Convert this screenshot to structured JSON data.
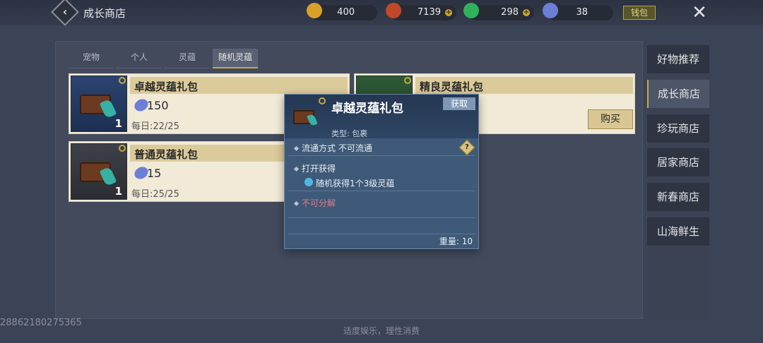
{
  "header": {
    "title": "成长商店",
    "currencies": [
      {
        "name": "gold",
        "value": "400",
        "color": "#d9a12a"
      },
      {
        "name": "copper",
        "value": "7139",
        "color": "#c0482a"
      },
      {
        "name": "jade",
        "value": "298",
        "color": "#2fb35a"
      },
      {
        "name": "crystal",
        "value": "38",
        "color": "#6c7fd6"
      }
    ],
    "wallet_label": "钱包"
  },
  "tabs": [
    {
      "label": "宠物"
    },
    {
      "label": "个人"
    },
    {
      "label": "灵蕴"
    },
    {
      "label": "随机灵蕴",
      "active": true
    }
  ],
  "items": [
    {
      "name": "卓越灵蕴礼包",
      "price": "150",
      "daily": "每日:22/25",
      "count": "1",
      "thumb_color": "blue"
    },
    {
      "name": "精良灵蕴礼包",
      "buy_label": "购买",
      "thumb_color": "green"
    },
    {
      "name": "普通灵蕴礼包",
      "price": "15",
      "daily": "每日:25/25",
      "count": "1",
      "thumb_color": "gray"
    }
  ],
  "side_nav": [
    {
      "label": "好物推荐"
    },
    {
      "label": "成长商店",
      "active": true
    },
    {
      "label": "珍玩商店"
    },
    {
      "label": "居家商店"
    },
    {
      "label": "新春商店"
    },
    {
      "label": "山海鲜生"
    }
  ],
  "tooltip": {
    "title": "卓越灵蕴礼包",
    "get_label": "获取",
    "type_text": "类型: 包裹",
    "circulation": "流通方式   不可流通",
    "open_title": "打开获得",
    "open_detail": "随机获得1个3级灵蕴",
    "no_decompose": "不可分解",
    "weight": "重量: 10"
  },
  "footer": {
    "uid": "28862180275365",
    "note": "适度娱乐，理性消费"
  }
}
